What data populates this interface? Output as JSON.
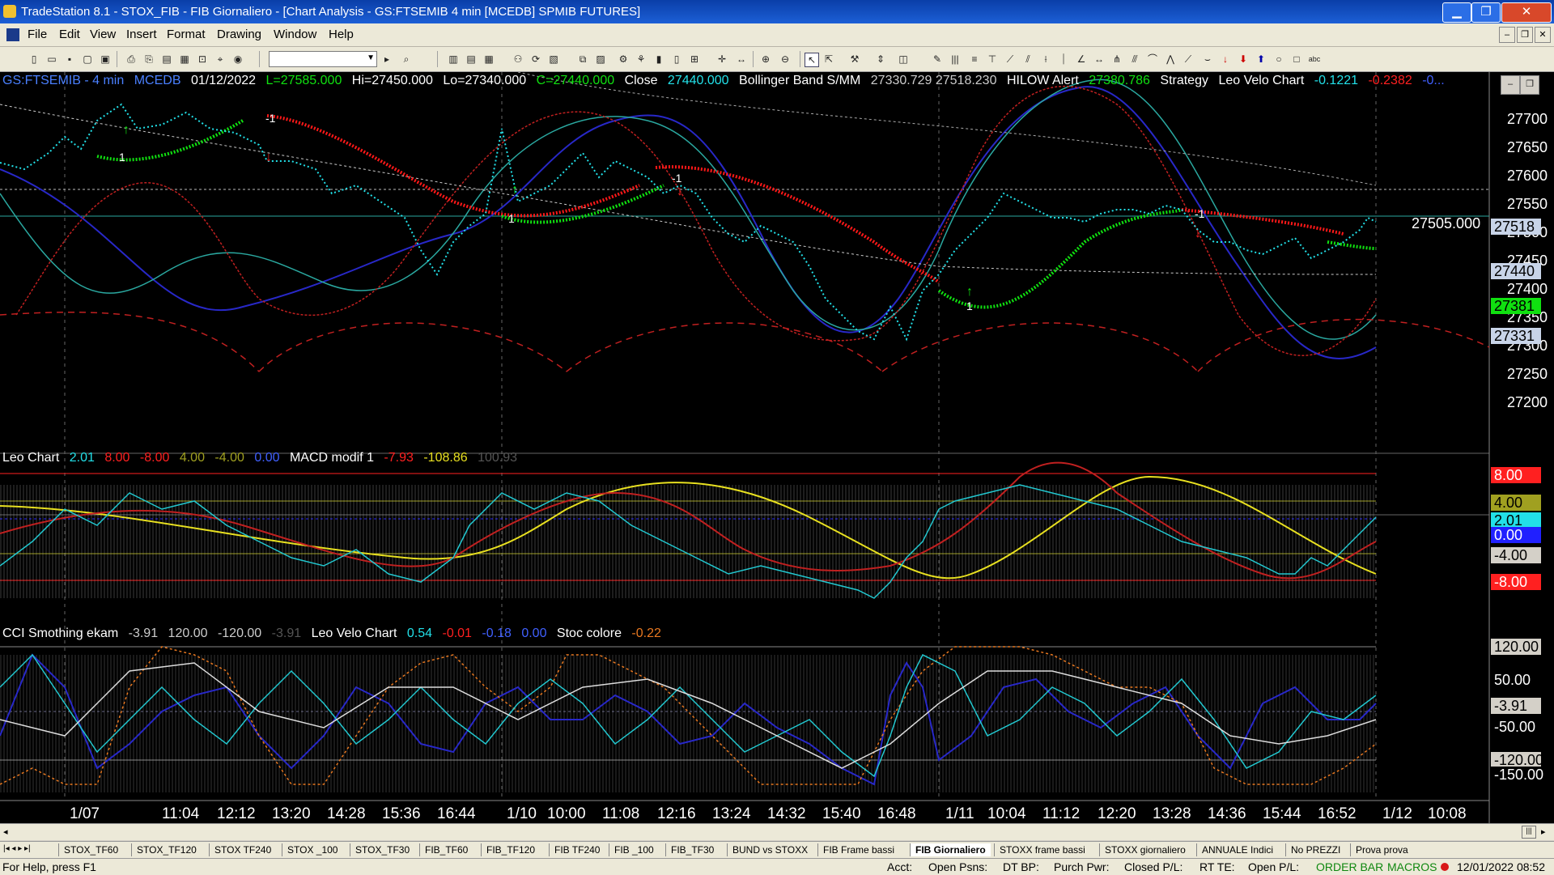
{
  "window": {
    "title": "TradeStation 8.1 - STOX_FIB - FIB Giornaliero - [Chart Analysis - GS:FTSEMIB  4 min  [MCEDB] SPMIB FUTURES]",
    "controls": [
      "minimize",
      "maximize",
      "close"
    ]
  },
  "menu": [
    "File",
    "Edit",
    "View",
    "Insert",
    "Format",
    "Drawing",
    "Window",
    "Help"
  ],
  "price_panel": {
    "symbol": "GS:FTSEMIB - 4 min",
    "exchange": "MCEDB",
    "date": "01/12/2022",
    "last": "L=27585.000",
    "high": "Hi=27450.000",
    "low": "Lo=27340.000",
    "close": "C=27440.000",
    "close_label": "Close",
    "close_value": "27440.000",
    "bollinger_label": "Bollinger Band S/MM",
    "bollinger_values": "27330.729  27518.230",
    "hilow_label": "HILOW Alert",
    "hilow_value": "27380.786",
    "strategy_label": "Strategy",
    "velo_label": "Leo Velo Chart",
    "velo_v1": "-0.1221",
    "velo_v2": "-0.2382",
    "velo_v3": "-0...",
    "level_label": "27505.000",
    "scale": [
      "27700",
      "27650",
      "27600",
      "27550",
      "27500",
      "27450",
      "27400",
      "27350",
      "27300",
      "27250",
      "27200"
    ],
    "tags": {
      "t1": "27518",
      "t2": "27440",
      "t3": "27381",
      "t4": "27331"
    },
    "trade_marks": [
      "1",
      "-1",
      "1",
      "-1",
      "-1",
      "1",
      "-1"
    ]
  },
  "macd_panel": {
    "label": "Leo Chart",
    "v1": "2.01",
    "v2": "8.00",
    "v3": "-8.00",
    "v4": "4.00",
    "v5": "-4.00",
    "v6": "0.00",
    "macd_label": "MACD modif 1",
    "m1": "-7.93",
    "m2": "-108.86",
    "m3": "100.93",
    "tags": [
      "8.00",
      "4.00",
      "2.01",
      "0.00",
      "-4.00",
      "-8.00"
    ]
  },
  "cci_panel": {
    "label": "CCI Smothing ekam",
    "c1": "-3.91",
    "c2": "120.00",
    "c3": "-120.00",
    "c4": "-3.91",
    "velo_label": "Leo Velo Chart",
    "v1": "0.54",
    "v2": "-0.01",
    "v3": "-0.18",
    "v4": "0.00",
    "stoc_label": "Stoc colore",
    "stoc_value": "-0.22",
    "tags": [
      "120.00",
      "50.00",
      "-3.91",
      "-50.00",
      "-120.00",
      "-150.00"
    ]
  },
  "time_axis": [
    "1/07",
    "11:04",
    "12:12",
    "13:20",
    "14:28",
    "15:36",
    "16:44",
    "1/10",
    "10:00",
    "11:08",
    "12:16",
    "13:24",
    "14:32",
    "15:40",
    "16:48",
    "1/11",
    "10:04",
    "11:12",
    "12:20",
    "13:28",
    "14:36",
    "15:44",
    "16:52",
    "1/12",
    "10:08"
  ],
  "tabs": [
    "STOX_TF60",
    "STOX_TF120",
    "STOX TF240",
    "STOX _100",
    "STOX_TF30",
    "FIB_TF60",
    "FIB_TF120",
    "FIB TF240",
    "FIB _100",
    "FIB_TF30",
    "BUND vs STOXX",
    "FIB Frame bassi",
    "FIB Giornaliero",
    "STOXX frame bassi",
    "STOXX giornaliero",
    "ANNUALE Indici",
    "No PREZZI",
    "Prova prova"
  ],
  "active_tab": "FIB Giornaliero",
  "status": {
    "help": "For Help, press F1",
    "acct": "Acct:",
    "open_psns": "Open Psns:",
    "dt_bp": "DT BP:",
    "purch_pwr": "Purch Pwr:",
    "closed_pl": "Closed P/L:",
    "rt_te": "RT TE:",
    "open_pl": "Open P/L:",
    "order_bar": "ORDER BAR",
    "macros": "MACROS",
    "datetime": "12/01/2022 08:52"
  },
  "colors": {
    "bg": "#000000",
    "price_dots": "#22e0e8",
    "trend_up": "#10e010",
    "trend_down": "#ff1818",
    "band_blue": "#2828c8",
    "band_teal": "#2aa8a0",
    "band_red": "#c02020",
    "macd_yellow": "#e8e020"
  }
}
